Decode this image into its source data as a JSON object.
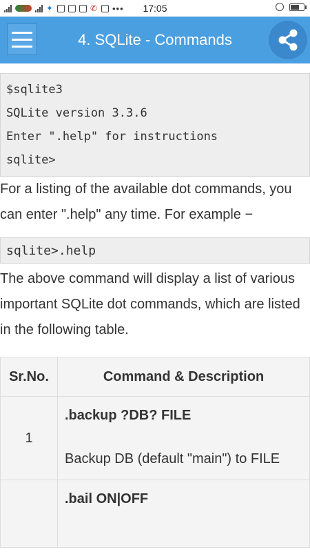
{
  "status_bar": {
    "time": "17:05",
    "overflow": "•••"
  },
  "app_bar": {
    "title": "4. SQLite - Commands",
    "accent_color": "#4a9fe0"
  },
  "content": {
    "code_block_1": [
      "$sqlite3",
      "SQLite version 3.3.6",
      "Enter \".help\" for instructions",
      "sqlite>"
    ],
    "para_1": "For a listing of the available dot commands, you can enter \".help\" any time. For example −",
    "code_block_2": "sqlite>.help",
    "para_2": "The above command will display a list of various important SQLite dot commands, which are listed in the following table.",
    "table": {
      "headers": [
        "Sr.No.",
        "Command & Description"
      ],
      "rows": [
        {
          "num": "1",
          "command": ".backup ?DB? FILE",
          "description": "Backup DB (default \"main\") to FILE"
        },
        {
          "num": "",
          "command": ".bail ON|OFF",
          "description": ""
        }
      ]
    }
  }
}
